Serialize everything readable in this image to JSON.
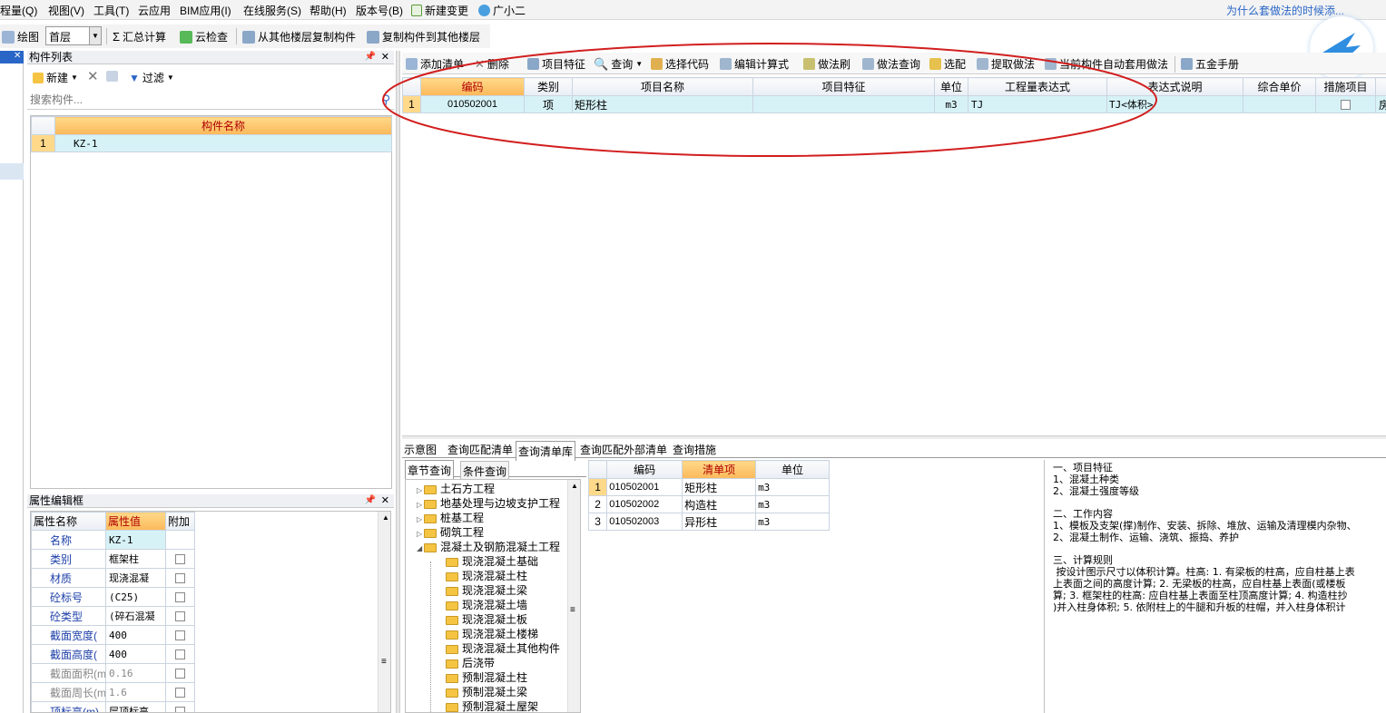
{
  "menu": {
    "items": [
      "程量(Q)",
      "视图(V)",
      "工具(T)",
      "云应用",
      "BIM应用(I)",
      "在线服务(S)",
      "帮助(H)",
      "版本号(B)",
      "新建变更",
      "广小二"
    ],
    "right_link": "为什么套做法的时候添..."
  },
  "toolbar1": {
    "draw": "绘图",
    "floor": "首层",
    "sum_calc": "汇总计算",
    "cloud_check": "云检查",
    "copy_from_floor": "从其他楼层复制构件",
    "copy_to_floor": "复制构件到其他楼层"
  },
  "component_list": {
    "title": "构件列表",
    "new_label": "新建",
    "filter_label": "过滤",
    "search_placeholder": "搜索构件...",
    "column_header": "构件名称",
    "rows": [
      {
        "num": "1",
        "name": "KZ-1"
      }
    ]
  },
  "property_editor": {
    "title": "属性编辑框",
    "headers": [
      "属性名称",
      "属性值",
      "附加"
    ],
    "rows": [
      {
        "name": "名称",
        "value": "KZ-1",
        "style": "blue",
        "checkbox": false
      },
      {
        "name": "类别",
        "value": "框架柱",
        "style": "blue",
        "checkbox": true
      },
      {
        "name": "材质",
        "value": "现浇混凝",
        "style": "blue",
        "checkbox": true
      },
      {
        "name": "砼标号",
        "value": "(C25)",
        "style": "blue",
        "checkbox": true
      },
      {
        "name": "砼类型",
        "value": "(碎石混凝",
        "style": "blue",
        "checkbox": true
      },
      {
        "name": "截面宽度(",
        "value": "400",
        "style": "blue",
        "checkbox": true
      },
      {
        "name": "截面高度(",
        "value": "400",
        "style": "blue",
        "checkbox": true
      },
      {
        "name": "截面面积(m",
        "value": "0.16",
        "style": "gray",
        "checkbox": true
      },
      {
        "name": "截面周长(m",
        "value": "1.6",
        "style": "gray",
        "checkbox": true
      },
      {
        "name": "顶标高(m)",
        "value": "层顶标高",
        "style": "blue",
        "checkbox": true
      }
    ]
  },
  "method_toolbar": {
    "add_list": "添加清单",
    "delete": "删除",
    "item_feature": "项目特征",
    "query": "查询",
    "select_code": "选择代码",
    "edit_formula": "编辑计算式",
    "method_brush": "做法刷",
    "method_query": "做法查询",
    "select_match": "选配",
    "extract_method": "提取做法",
    "auto_apply": "当前构件自动套用做法",
    "hardware_manual": "五金手册"
  },
  "method_table": {
    "headers": [
      "编码",
      "类别",
      "项目名称",
      "项目特征",
      "单位",
      "工程量表达式",
      "表达式说明",
      "综合单价",
      "措施项目"
    ],
    "rows": [
      {
        "num": "1",
        "code": "010502001",
        "type": "项",
        "name": "矩形柱",
        "feature": "",
        "unit": "m3",
        "expr": "TJ",
        "expr_desc": "TJ<体积>",
        "price": "",
        "measure": false,
        "extra": "房屋建"
      }
    ]
  },
  "bottom_tabs": [
    "示意图",
    "查询匹配清单",
    "查询清单库",
    "查询匹配外部清单",
    "查询措施"
  ],
  "sub_tabs": [
    "章节查询",
    "条件查询"
  ],
  "tree": {
    "top_items": [
      "土石方工程",
      "地基处理与边坡支护工程",
      "桩基工程",
      "砌筑工程",
      "混凝土及钢筋混凝土工程"
    ],
    "children": [
      "现浇混凝土基础",
      "现浇混凝土柱",
      "现浇混凝土梁",
      "现浇混凝土墙",
      "现浇混凝土板",
      "现浇混凝土楼梯",
      "现浇混凝土其他构件",
      "后浇带",
      "预制混凝土柱",
      "预制混凝土梁",
      "预制混凝土屋架"
    ]
  },
  "list_table": {
    "headers": [
      "编码",
      "清单项",
      "单位"
    ],
    "rows": [
      {
        "num": "1",
        "code": "010502001",
        "name": "矩形柱",
        "unit": "m3"
      },
      {
        "num": "2",
        "code": "010502002",
        "name": "构造柱",
        "unit": "m3"
      },
      {
        "num": "3",
        "code": "010502003",
        "name": "异形柱",
        "unit": "m3"
      }
    ]
  },
  "description": {
    "lines": [
      "一、项目特征",
      "1、混凝土种类",
      "2、混凝土强度等级",
      "",
      "二、工作内容",
      "1、模板及支架(撑)制作、安装、拆除、堆放、运输及清理模内杂物、",
      "2、混凝土制作、运输、浇筑、振捣、养护",
      "",
      "三、计算规则",
      " 按设计图示尺寸以体积计算。柱高: 1. 有梁板的柱高，应自柱基上表",
      "上表面之间的高度计算; 2. 无梁板的柱高，应自柱基上表面(或楼板",
      "算; 3. 框架柱的柱高: 应自柱基上表面至柱顶高度计算; 4. 构造柱抄",
      ")并入柱身体积; 5. 依附柱上的牛腿和升板的柱帽，并入柱身体积计"
    ]
  },
  "colors": {
    "accent_red": "#d21e1e",
    "header_orange": "#fbb85a",
    "selected_row": "#d6f2f7",
    "link_blue": "#2a66c7"
  }
}
